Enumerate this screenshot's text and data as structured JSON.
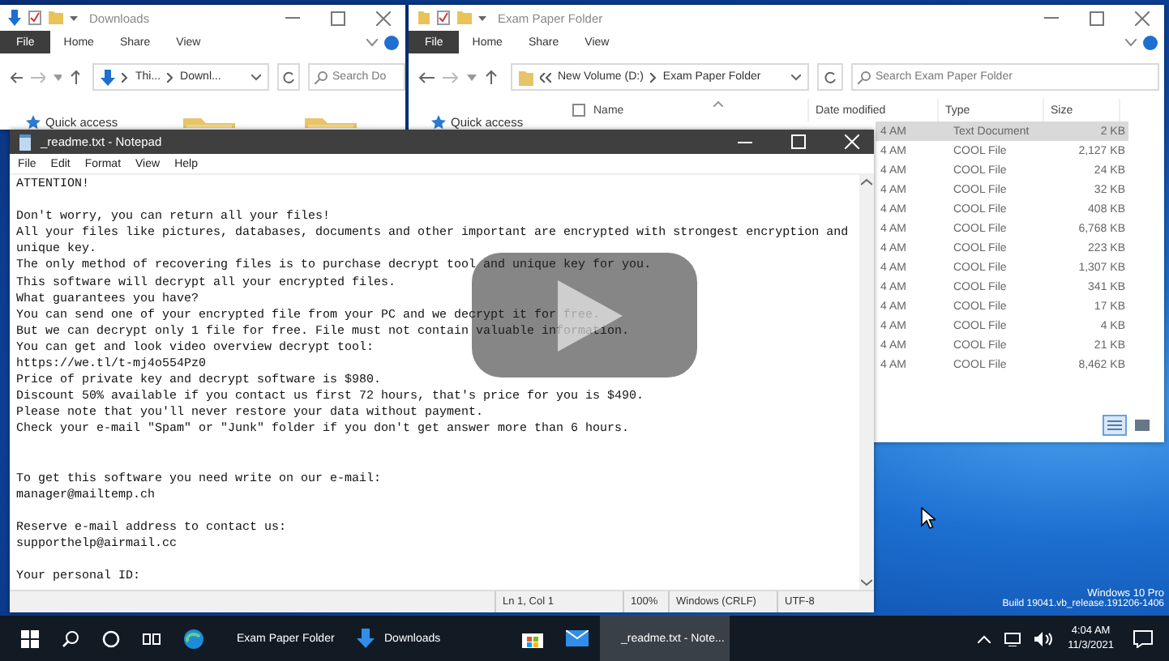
{
  "downloads_window": {
    "title": "Downloads",
    "ribbon_tabs": [
      {
        "label": "File",
        "kind": "file"
      },
      {
        "label": "Home",
        "kind": "tab"
      },
      {
        "label": "Share",
        "kind": "tab"
      },
      {
        "label": "View",
        "kind": "tab"
      }
    ],
    "address": [
      "Thi...",
      "Downl..."
    ],
    "search_placeholder": "Search Do",
    "nav_items": [
      "Quick access"
    ]
  },
  "folder_window": {
    "title": "Exam Paper Folder",
    "ribbon_tabs": [
      {
        "label": "File",
        "kind": "file"
      },
      {
        "label": "Home",
        "kind": "tab"
      },
      {
        "label": "Share",
        "kind": "tab"
      },
      {
        "label": "View",
        "kind": "tab"
      }
    ],
    "address": [
      "New Volume (D:)",
      "Exam Paper Folder"
    ],
    "search_placeholder": "Search Exam Paper Folder",
    "nav_items": [
      "Quick access"
    ],
    "select_all_checked": false,
    "columns": [
      "Name",
      "Date modified",
      "Type",
      "Size"
    ],
    "rows": [
      {
        "date": "4 AM",
        "type": "Text Document",
        "size": "2 KB",
        "selected": true
      },
      {
        "date": "4 AM",
        "type": "COOL File",
        "size": "2,127 KB",
        "selected": false
      },
      {
        "date": "4 AM",
        "type": "COOL File",
        "size": "24 KB",
        "selected": false
      },
      {
        "date": "4 AM",
        "type": "COOL File",
        "size": "32 KB",
        "selected": false
      },
      {
        "date": "4 AM",
        "type": "COOL File",
        "size": "408 KB",
        "selected": false
      },
      {
        "date": "4 AM",
        "type": "COOL File",
        "size": "6,768 KB",
        "selected": false
      },
      {
        "date": "4 AM",
        "type": "COOL File",
        "size": "223 KB",
        "selected": false
      },
      {
        "date": "4 AM",
        "type": "COOL File",
        "size": "1,307 KB",
        "selected": false
      },
      {
        "date": "4 AM",
        "type": "COOL File",
        "size": "341 KB",
        "selected": false
      },
      {
        "date": "4 AM",
        "type": "COOL File",
        "size": "17 KB",
        "selected": false
      },
      {
        "date": "4 AM",
        "type": "COOL File",
        "size": "4 KB",
        "selected": false
      },
      {
        "date": "4 AM",
        "type": "COOL File",
        "size": "21 KB",
        "selected": false
      },
      {
        "date": "4 AM",
        "type": "COOL File",
        "size": "8,462 KB",
        "selected": false
      }
    ]
  },
  "notepad": {
    "title": "_readme.txt - Notepad",
    "menu": [
      "File",
      "Edit",
      "Format",
      "View",
      "Help"
    ],
    "text": "ATTENTION!\n\nDon't worry, you can return all your files!\nAll your files like pictures, databases, documents and other important are encrypted with strongest encryption and\nunique key.\nThe only method of recovering files is to purchase decrypt tool and unique key for you.\nThis software will decrypt all your encrypted files.\nWhat guarantees you have?\nYou can send one of your encrypted file from your PC and we decrypt it for free.\nBut we can decrypt only 1 file for free. File must not contain valuable information.\nYou can get and look video overview decrypt tool:\nhttps://we.tl/t-mj4o554Pz0\nPrice of private key and decrypt software is $980.\nDiscount 50% available if you contact us first 72 hours, that's price for you is $490.\nPlease note that you'll never restore your data without payment.\nCheck your e-mail \"Spam\" or \"Junk\" folder if you don't get answer more than 6 hours.\n\n\nTo get this software you need write on our e-mail:\nmanager@mailtemp.ch\n\nReserve e-mail address to contact us:\nsupporthelp@airmail.cc\n\nYour personal ID:",
    "status": [
      "Ln 1, Col 1",
      "100%",
      "Windows (CRLF)",
      "UTF-8"
    ]
  },
  "desktop": {
    "edition": "Windows 10 Pro",
    "build": "Build 19041.vb_release.191206-1406"
  },
  "taskbar": {
    "apps": [
      {
        "kind": "edge",
        "active": false
      },
      {
        "kind": "folder",
        "label": "Exam Paper Folder",
        "active": false
      },
      {
        "kind": "download",
        "label": "Downloads",
        "active": false
      },
      {
        "kind": "store",
        "active": false
      },
      {
        "kind": "mail",
        "active": false
      },
      {
        "kind": "notepad",
        "label": "_readme.txt - Note...",
        "active": true
      }
    ],
    "time": "4:04 AM",
    "date": "11/3/2021"
  }
}
